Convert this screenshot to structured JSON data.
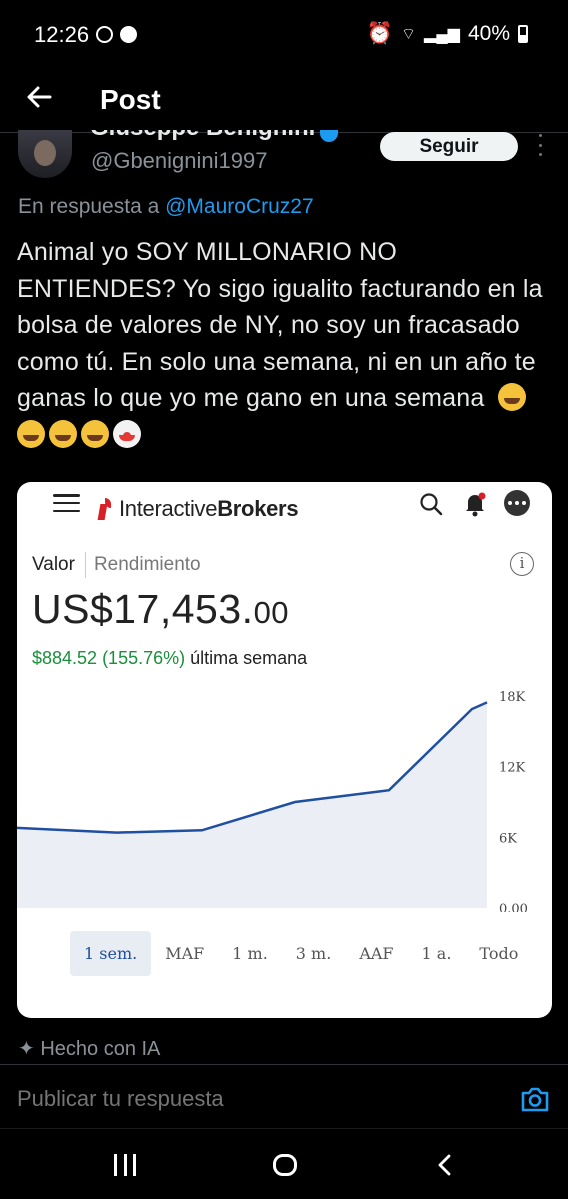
{
  "status_bar": {
    "time": "12:26",
    "battery": "40%"
  },
  "header": {
    "title": "Post"
  },
  "user": {
    "name": "Giuseppe Benignini",
    "handle": "@Gbenignini1997",
    "follow_label": "Seguir"
  },
  "reply_to": {
    "prefix": "En respuesta a",
    "mention": "@MauroCruz27"
  },
  "tweet": {
    "text": "Animal yo SOY MILLONARIO NO ENTIENDES? Yo sigo igualito facturando en la bolsa de valores de NY, no soy un fracasado como tú. En solo una semana, ni en un año te ganas lo que yo me gano en una semana"
  },
  "card": {
    "brand_light": "Interactive",
    "brand_bold": "Brokers",
    "tab_value": "Valor",
    "tab_return": "Rendimiento",
    "value_main": "US$17,453.",
    "value_cents": "00",
    "change_amount": "$884.52 (155.76%)",
    "change_period": "última semana",
    "ranges": [
      "1 sem.",
      "MAF",
      "1 m.",
      "3 m.",
      "AAF",
      "1 a.",
      "Todo"
    ],
    "selected_range": "1 sem."
  },
  "chart_data": {
    "type": "area",
    "y_ticks": [
      "18K",
      "12K",
      "6K",
      "0.00"
    ],
    "ylim": [
      0,
      18000
    ],
    "x": [
      0,
      1,
      2,
      3,
      4,
      5,
      6
    ],
    "values": [
      6800,
      6400,
      6600,
      9000,
      10000,
      16900,
      17453
    ],
    "line_color": "#1f4fa0",
    "fill_color": "#eceef5"
  },
  "footer": {
    "ai_label": "Hecho con IA",
    "reply_placeholder": "Publicar tu respuesta"
  },
  "colors": {
    "accent": "#1d9bf0",
    "gain": "#1a8f3c",
    "brand_red": "#d81f26"
  }
}
